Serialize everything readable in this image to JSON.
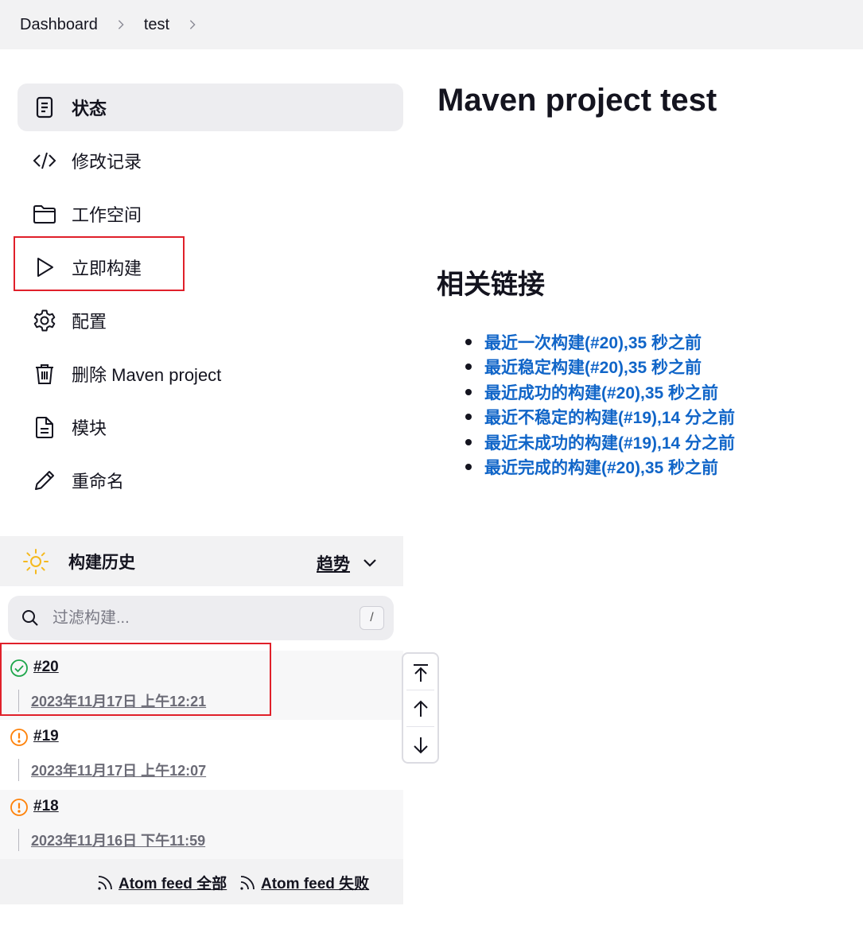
{
  "breadcrumb": {
    "items": [
      "Dashboard",
      "test"
    ]
  },
  "sidebar": {
    "items": [
      {
        "label": "状态",
        "icon": "status-icon",
        "active": true
      },
      {
        "label": "修改记录",
        "icon": "code-icon"
      },
      {
        "label": "工作空间",
        "icon": "folder-icon"
      },
      {
        "label": "立即构建",
        "icon": "play-icon"
      },
      {
        "label": "配置",
        "icon": "gear-icon"
      },
      {
        "label": "删除 Maven project",
        "icon": "trash-icon"
      },
      {
        "label": "模块",
        "icon": "document-icon"
      },
      {
        "label": "重命名",
        "icon": "pencil-icon"
      }
    ]
  },
  "history": {
    "title": "构建历史",
    "trend_label": "趋势",
    "filter_placeholder": "过滤构建...",
    "filter_shortcut": "/",
    "builds": [
      {
        "number": "#20",
        "time": "2023年11月17日 上午12:21",
        "status": "success"
      },
      {
        "number": "#19",
        "time": "2023年11月17日 上午12:07",
        "status": "unstable"
      },
      {
        "number": "#18",
        "time": "2023年11月16日 下午11:59",
        "status": "unstable"
      }
    ],
    "feeds": [
      "Atom feed 全部",
      "Atom feed 失败"
    ]
  },
  "main": {
    "title": "Maven project test",
    "related_title": "相关链接",
    "links": [
      "最近一次构建(#20),35 秒之前",
      "最近稳定构建(#20),35 秒之前",
      "最近成功的构建(#20),35 秒之前",
      "最近不稳定的构建(#19),14 分之前",
      "最近未成功的构建(#19),14 分之前",
      "最近完成的构建(#20),35 秒之前"
    ]
  },
  "colors": {
    "link": "#1065c8",
    "success": "#1ea64b",
    "unstable": "#fe820a",
    "highlight": "#e0202a",
    "sun": "#f5b91e"
  }
}
